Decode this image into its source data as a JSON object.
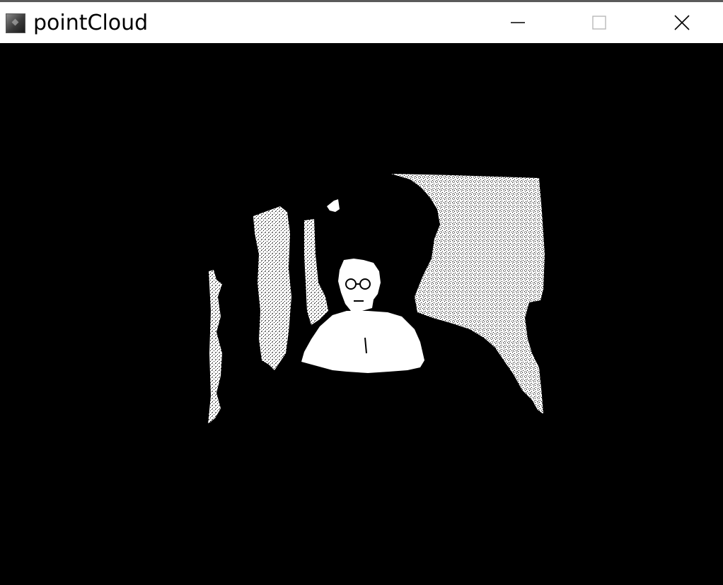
{
  "window": {
    "title": "pointCloud",
    "app_icon": "opencv-window-icon",
    "controls": {
      "minimize_icon": "minimize-icon",
      "maximize_icon": "maximize-icon",
      "close_icon": "close-icon"
    }
  },
  "viewport": {
    "background_color": "#000000",
    "point_color": "#ffffff"
  }
}
